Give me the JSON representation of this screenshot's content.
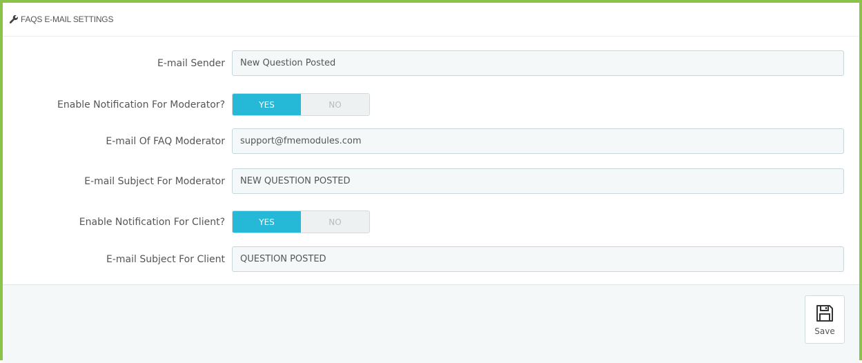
{
  "panel": {
    "title": "FAQS E-MAIL SETTINGS",
    "title_icon": "wrench-icon",
    "accent_color": "#8bc34a"
  },
  "fields": {
    "email_sender": {
      "label": "E-mail Sender",
      "value": "New Question Posted"
    },
    "notify_moderator": {
      "label": "Enable Notification For Moderator?",
      "yes": "YES",
      "no": "NO",
      "selected": "YES"
    },
    "moderator_email": {
      "label": "E-mail Of FAQ Moderator",
      "value": "support@fmemodules.com"
    },
    "moderator_subject": {
      "label": "E-mail Subject For Moderator",
      "value": "NEW QUESTION POSTED"
    },
    "notify_client": {
      "label": "Enable Notification For Client?",
      "yes": "YES",
      "no": "NO",
      "selected": "YES"
    },
    "client_subject": {
      "label": "E-mail Subject For Client",
      "value": "QUESTION POSTED"
    }
  },
  "footer": {
    "save_label": "Save",
    "save_icon": "floppy-disk-icon"
  },
  "colors": {
    "switch_active": "#25b9d7",
    "input_background": "#f5f8f9"
  }
}
